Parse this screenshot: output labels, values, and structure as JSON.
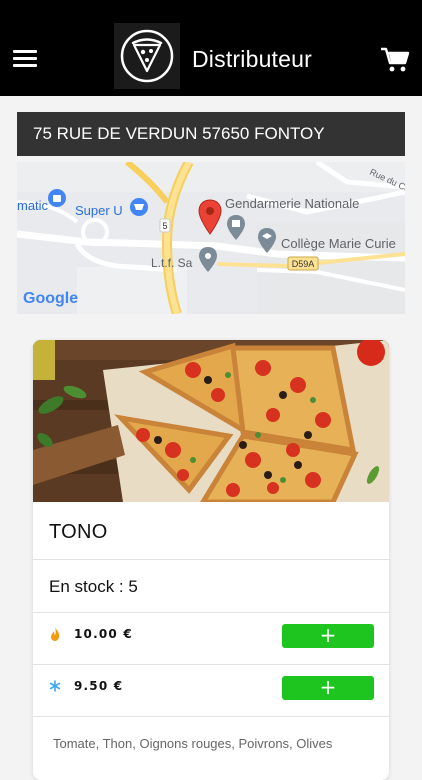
{
  "header": {
    "title": "Distributeur",
    "menu_icon": "hamburger-menu-icon",
    "logo_icon": "pizza-slice-logo",
    "cart_icon": "shopping-cart-icon"
  },
  "address": {
    "text": "75 RUE DE VERDUN 57650 FONTOY"
  },
  "map": {
    "labels": {
      "matic": "matic",
      "super_u": "Super U",
      "gendarmerie": "Gendarmerie Nationale",
      "college": "Collège Marie Curie",
      "ltf": "L.t.f. Sa",
      "road_d59a": "D59A",
      "road_5": "5",
      "rue": "Rue du Co",
      "google": "Google"
    }
  },
  "product": {
    "name": "TONO",
    "stock_label": "En stock : 5",
    "prices": [
      {
        "icon": "flame-icon",
        "value": "10.00  €",
        "button": "+"
      },
      {
        "icon": "snowflake-icon",
        "value": "9.50  €",
        "button": "+"
      }
    ],
    "ingredients": "Tomate, Thon, Oignons rouges, Poivrons, Olives"
  },
  "colors": {
    "header_bg": "#000000",
    "address_bg": "#333333",
    "add_button": "#1ec51e",
    "flame": "#f39c12",
    "snowflake": "#3fa9f5",
    "map_pin": "#ea4335"
  }
}
